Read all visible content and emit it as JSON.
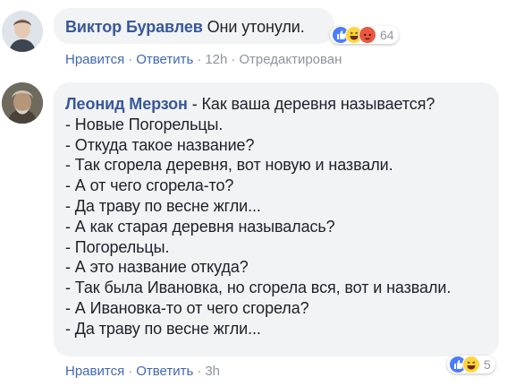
{
  "comments": [
    {
      "author": "Виктор Буравлев",
      "text": "Они утонули.",
      "reactions": {
        "types": [
          "like-icon",
          "haha-icon",
          "angry-icon"
        ],
        "count": "64"
      },
      "actions": {
        "like": "Нравится",
        "reply": "Ответить",
        "time": "12h",
        "edited": "Отредактирован"
      }
    },
    {
      "author": "Леонид Мерзон",
      "lines": [
        "Как ваша деревня называется?",
        "- Новые Погорельцы.",
        "- Откуда такое название?",
        "- Так сгорела деревня, вот новую и назвали.",
        "- А от чего сгорела-то?",
        "- Да траву по весне жгли...",
        "- А как старая деревня называлась?",
        "- Погорельцы.",
        "- А это название откуда?",
        "- Так была Ивановка, но сгорела вся, вот и назвали.",
        "- А Ивановка-то от чего сгорела?",
        "- Да траву по весне жгли..."
      ],
      "reactions": {
        "types": [
          "like-icon",
          "haha-icon"
        ],
        "count": "5"
      },
      "actions": {
        "like": "Нравится",
        "reply": "Ответить",
        "time": "3h"
      }
    }
  ],
  "separator": " · ",
  "dash": " - ",
  "colors": {
    "link": "#4267b2",
    "author": "#385898",
    "meta": "#90949c",
    "bubble": "#f2f3f5"
  }
}
